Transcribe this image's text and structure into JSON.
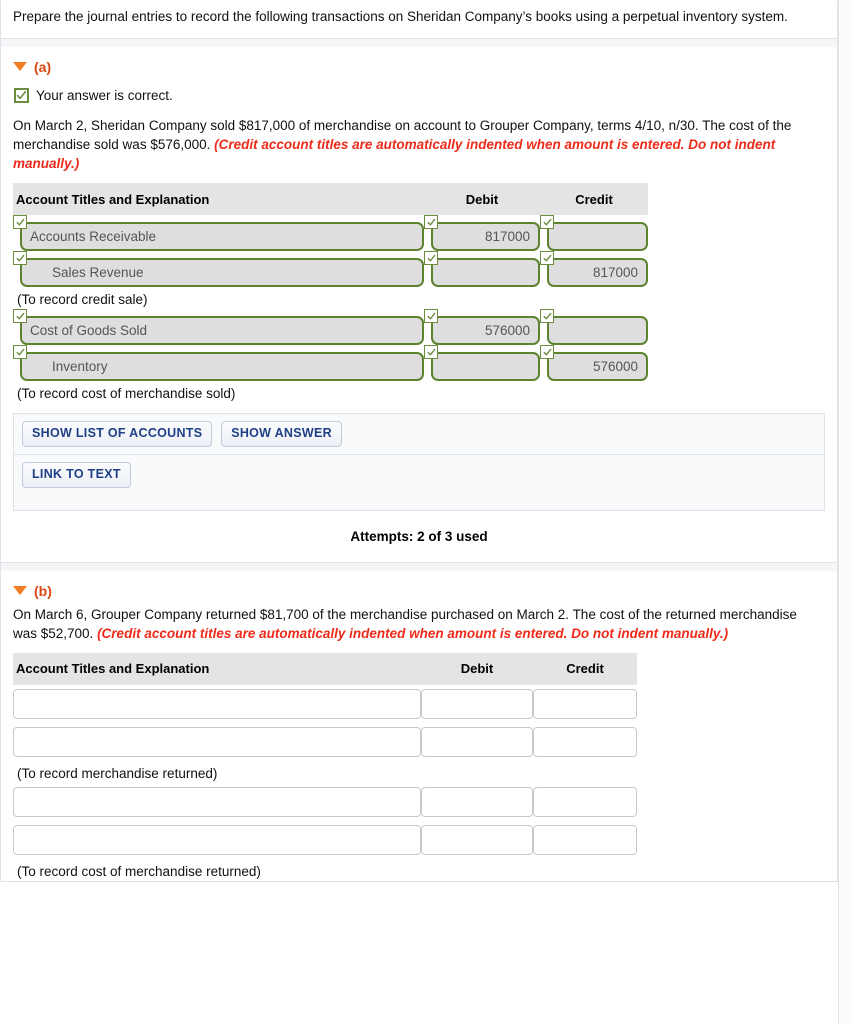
{
  "prompt": {
    "text": "Prepare the journal entries to record the following transactions on Sheridan Company’s books using a perpetual inventory system."
  },
  "icons": {
    "collapse_triangle": "triangle-down-icon",
    "check": "check-icon"
  },
  "colors": {
    "section_label": "#d9450f",
    "triangle": "#f07e26",
    "red_note": "#ee2b1a",
    "answered_border": "#5d8230",
    "answered_fill": "#dedede",
    "button_text": "#1f3f87",
    "table_header_bg": "#e4e4e4"
  },
  "table_headers": {
    "account": "Account Titles and Explanation",
    "debit": "Debit",
    "credit": "Credit"
  },
  "sections": [
    {
      "id": "a",
      "label": "(a)",
      "status": {
        "text": "Your answer is correct.",
        "state": "correct"
      },
      "question": {
        "main": "On March 2, Sheridan Company sold $817,000 of merchandise on account to Grouper Company, terms 4/10, n/30. The cost of the merchandise sold was $576,000. ",
        "note": "(Credit account titles are automatically indented when amount is entered. Do not indent manually.)"
      },
      "rows": [
        {
          "account": "Accounts Receivable",
          "debit": "817000",
          "credit": "",
          "indent": false,
          "answered": true
        },
        {
          "account": "Sales Revenue",
          "debit": "",
          "credit": "817000",
          "indent": true,
          "answered": true
        },
        {
          "memo": "(To record credit sale)"
        },
        {
          "account": "Cost of Goods Sold",
          "debit": "576000",
          "credit": "",
          "indent": false,
          "answered": true
        },
        {
          "account": "Inventory",
          "debit": "",
          "credit": "576000",
          "indent": true,
          "answered": true
        },
        {
          "memo": "(To record cost of merchandise sold)"
        }
      ],
      "buttons_row1": [
        {
          "label": "SHOW LIST OF ACCOUNTS",
          "name": "show-list-of-accounts-button"
        },
        {
          "label": "SHOW ANSWER",
          "name": "show-answer-button"
        }
      ],
      "buttons_row2": [
        {
          "label": "LINK TO TEXT",
          "name": "link-to-text-button"
        }
      ],
      "attempts": "Attempts: 2 of 3 used"
    },
    {
      "id": "b",
      "label": "(b)",
      "question": {
        "main": "On March 6, Grouper Company returned $81,700 of the merchandise purchased on March 2. The cost of the returned merchandise was $52,700. ",
        "note": "(Credit account titles are automatically indented when amount is entered. Do not indent manually.)"
      },
      "rows": [
        {
          "account": "",
          "debit": "",
          "credit": "",
          "indent": false,
          "answered": false
        },
        {
          "account": "",
          "debit": "",
          "credit": "",
          "indent": false,
          "answered": false
        },
        {
          "memo": "(To record merchandise returned)"
        },
        {
          "account": "",
          "debit": "",
          "credit": "",
          "indent": false,
          "answered": false
        },
        {
          "account": "",
          "debit": "",
          "credit": "",
          "indent": false,
          "answered": false
        },
        {
          "memo": "(To record cost of merchandise returned)"
        }
      ]
    }
  ]
}
